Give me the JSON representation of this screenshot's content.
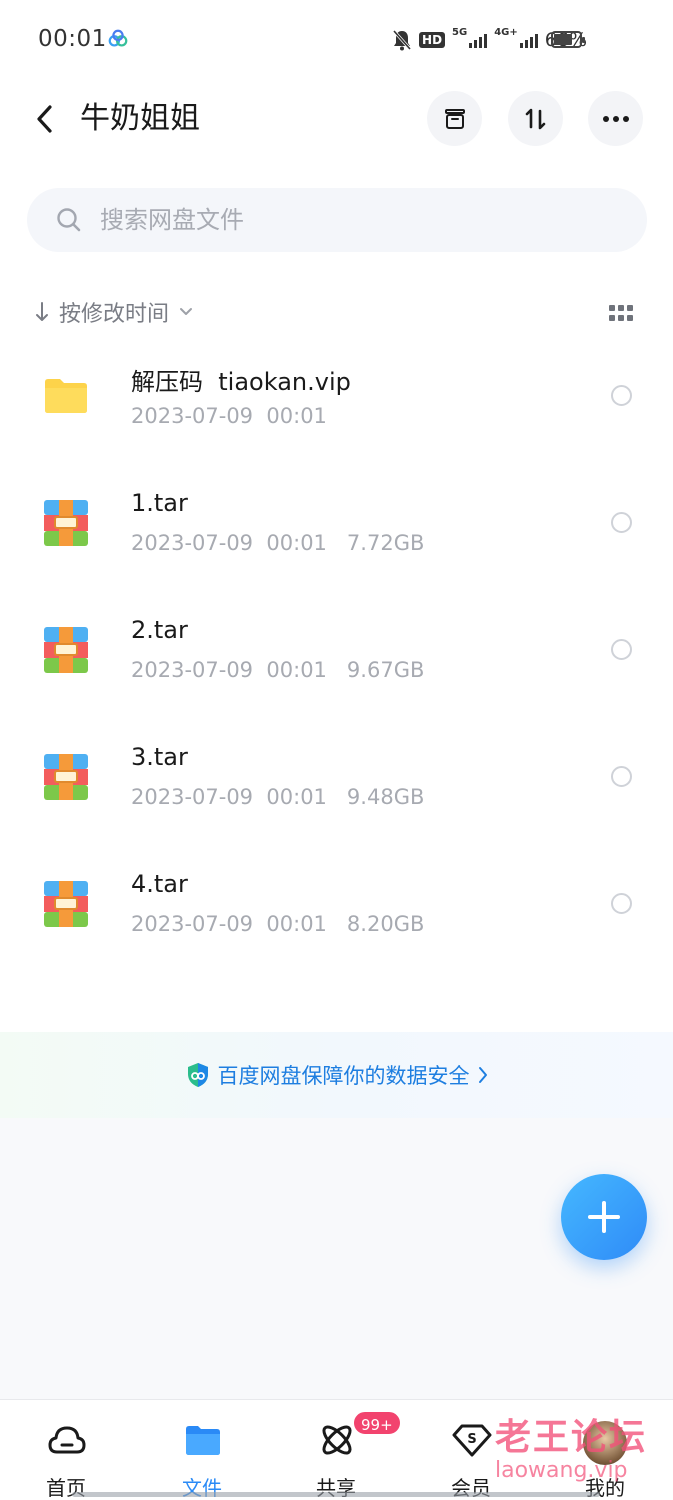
{
  "status_bar": {
    "time": "00:01",
    "hd_label": "HD",
    "net1_label": "5G",
    "net2_label": "4G+",
    "battery_percent": "66%",
    "battery_level": 0.66
  },
  "header": {
    "title": "牛奶姐姐"
  },
  "search": {
    "placeholder": "搜索网盘文件"
  },
  "sort": {
    "label": "按修改时间"
  },
  "files": [
    {
      "name": "解压码  tiaokan.vip",
      "meta": "2023-07-09  00:01",
      "type": "folder"
    },
    {
      "name": "1.tar",
      "meta": "2023-07-09  00:01   7.72GB",
      "type": "archive"
    },
    {
      "name": "2.tar",
      "meta": "2023-07-09  00:01   9.67GB",
      "type": "archive"
    },
    {
      "name": "3.tar",
      "meta": "2023-07-09  00:01   9.48GB",
      "type": "archive"
    },
    {
      "name": "4.tar",
      "meta": "2023-07-09  00:01   8.20GB",
      "type": "archive"
    }
  ],
  "security_banner": {
    "text": "百度网盘保障你的数据安全"
  },
  "bottom_nav": {
    "items": [
      {
        "label": "首页",
        "icon": "cloud-home-icon"
      },
      {
        "label": "文件",
        "icon": "folder-icon"
      },
      {
        "label": "共享",
        "icon": "atom-share-icon"
      },
      {
        "label": "会员",
        "icon": "diamond-vip-icon"
      },
      {
        "label": "我的",
        "icon": "avatar"
      }
    ],
    "share_badge": "99+",
    "active": "文件"
  },
  "watermark": {
    "cn": "老王论坛",
    "en": "laowang.vip"
  },
  "colors": {
    "accent": "#2a8af6",
    "folder": "#fdd34a",
    "badge": "#f2436e"
  }
}
